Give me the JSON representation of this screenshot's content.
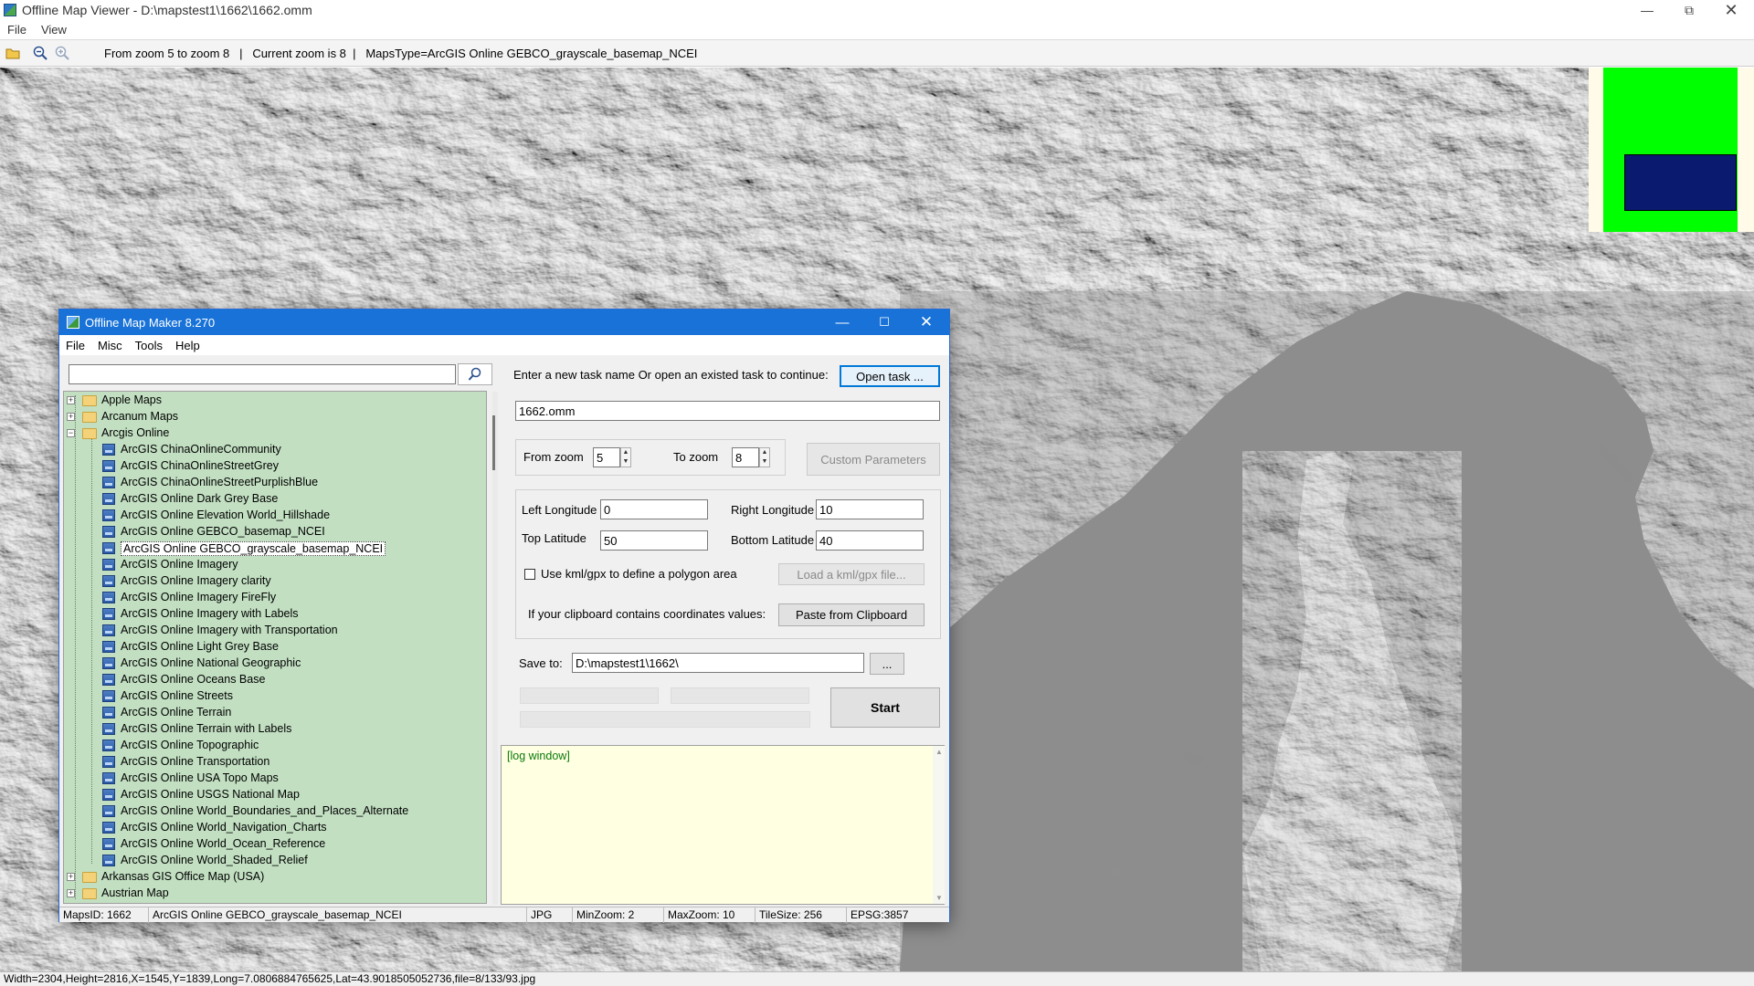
{
  "viewer": {
    "title": "Offline Map Viewer - D:\\mapstest1\\1662\\1662.omm",
    "menu": [
      "File",
      "View"
    ],
    "toolbar_status": "From zoom 5 to zoom 8   |   Current zoom is 8  |   MapsType=ArcGIS Online GEBCO_grayscale_basemap_NCEI",
    "statusbar": "Width=2304,Height=2816,X=1545,Y=1839,Long=7.0806884765625,Lat=43.9018505052736,file=8/133/93.jpg"
  },
  "dialog": {
    "title": "Offline Map Maker 8.270",
    "menu": [
      "File",
      "Misc",
      "Tools",
      "Help"
    ],
    "search_value": "",
    "tree": {
      "roots_before": [
        {
          "label": "Apple Maps",
          "expanded": false
        },
        {
          "label": "Arcanum Maps",
          "expanded": false
        },
        {
          "label": "Arcgis Online",
          "expanded": true
        }
      ],
      "children": [
        "ArcGIS ChinaOnlineCommunity",
        "ArcGIS ChinaOnlineStreetGrey",
        "ArcGIS ChinaOnlineStreetPurplishBlue",
        "ArcGIS Online Dark Grey Base",
        "ArcGIS Online Elevation World_Hillshade",
        "ArcGIS Online GEBCO_basemap_NCEI",
        "ArcGIS Online GEBCO_grayscale_basemap_NCEI",
        "ArcGIS Online Imagery",
        "ArcGIS Online Imagery clarity",
        "ArcGIS Online Imagery FireFly",
        "ArcGIS Online Imagery with Labels",
        "ArcGIS Online Imagery with Transportation",
        "ArcGIS Online Light Grey Base",
        "ArcGIS Online National Geographic",
        "ArcGIS Online Oceans Base",
        "ArcGIS Online Streets",
        "ArcGIS Online Terrain",
        "ArcGIS Online Terrain with Labels",
        "ArcGIS Online Topographic",
        "ArcGIS Online Transportation",
        "ArcGIS Online USA Topo Maps",
        "ArcGIS Online USGS National Map",
        "ArcGIS Online World_Boundaries_and_Places_Alternate",
        "ArcGIS Online World_Navigation_Charts",
        "ArcGIS Online World_Ocean_Reference",
        "ArcGIS Online World_Shaded_Relief"
      ],
      "selected": "ArcGIS Online GEBCO_grayscale_basemap_NCEI",
      "roots_after": [
        {
          "label": "Arkansas GIS Office Map (USA)",
          "expanded": false
        },
        {
          "label": "Austrian Map",
          "expanded": false
        }
      ]
    },
    "task_prompt": "Enter a new task name Or open an existed task to continue:",
    "open_task_label": "Open task ...",
    "task_name": "1662.omm",
    "from_zoom_label": "From zoom",
    "from_zoom": "5",
    "to_zoom_label": "To zoom",
    "to_zoom": "8",
    "custom_params_label": "Custom Parameters",
    "left_lon_label": "Left Longitude",
    "left_lon": "0",
    "right_lon_label": "Right Longitude",
    "right_lon": "10",
    "top_lat_label": "Top Latitude",
    "top_lat": "50",
    "bottom_lat_label": "Bottom Latitude",
    "bottom_lat": "40",
    "kml_label": "Use kml/gpx to define a polygon area",
    "kml_checked": false,
    "load_kml_label": "Load a kml/gpx file...",
    "clipboard_prompt": "If your clipboard contains coordinates values:",
    "paste_label": "Paste from Clipboard",
    "save_label": "Save to:",
    "save_path": "D:\\mapstest1\\1662\\",
    "browse_label": "...",
    "start_label": "Start",
    "log_text": "[log window]",
    "status": {
      "mapsid": "MapsID: 1662",
      "name": "ArcGIS Online GEBCO_grayscale_basemap_NCEI",
      "format": "JPG",
      "minzoom": "MinZoom: 2",
      "maxzoom": "MaxZoom: 10",
      "tilesize": "TileSize: 256",
      "epsg": "EPSG:3857"
    }
  },
  "colors": {
    "dialog_title": "#1872d8",
    "tree_bg": "#c2dfc2",
    "log_bg": "#ffffe1",
    "minimap_view": "#00ff00",
    "minimap_selection": "#0a1a6e"
  },
  "icons": [
    "app-icon",
    "open-folder-icon",
    "zoom-out-icon",
    "zoom-in-icon",
    "minimize-icon",
    "maximize-icon",
    "close-icon",
    "search-icon",
    "folder-icon",
    "map-layer-icon"
  ]
}
